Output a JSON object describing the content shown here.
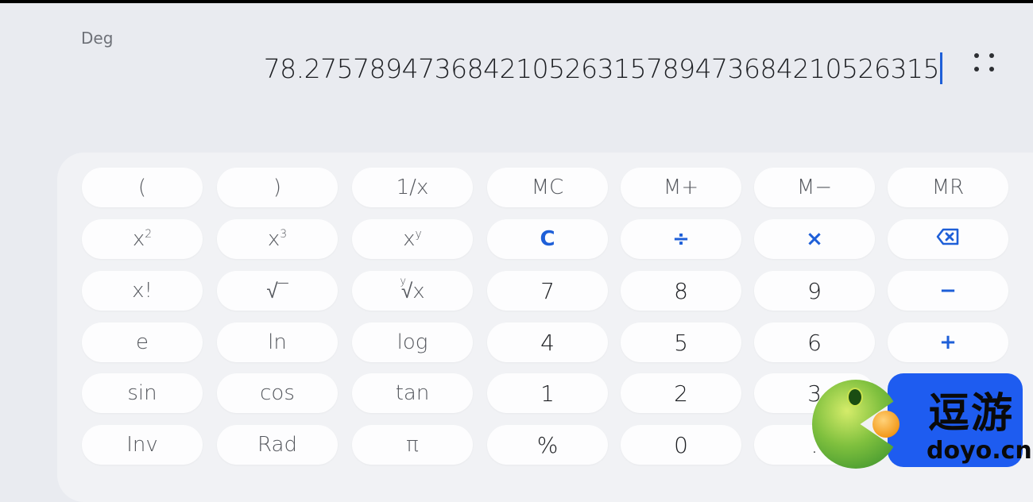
{
  "display": {
    "angle_mode": "Deg",
    "value": "78.275789473684210526315789473684210526315",
    "more_icon": "more-dots-icon"
  },
  "keypad": {
    "rows": [
      [
        {
          "label": "(",
          "type": "fn"
        },
        {
          "label": ")",
          "type": "fn"
        },
        {
          "label": "1/x",
          "type": "fn"
        },
        {
          "label": "MC",
          "type": "fn"
        },
        {
          "label": "M+",
          "type": "fn"
        },
        {
          "label": "M−",
          "type": "fn"
        },
        {
          "label": "MR",
          "type": "fn"
        }
      ],
      [
        {
          "label": "x²",
          "base": "x",
          "sup": "2",
          "type": "fn"
        },
        {
          "label": "x³",
          "base": "x",
          "sup": "3",
          "type": "fn"
        },
        {
          "label": "xʸ",
          "base": "x",
          "sup": "y",
          "type": "fn"
        },
        {
          "label": "C",
          "type": "op"
        },
        {
          "label": "÷",
          "type": "op"
        },
        {
          "label": "×",
          "type": "op"
        },
        {
          "label": "⌫",
          "type": "op",
          "icon": "backspace-icon"
        }
      ],
      [
        {
          "label": "x!",
          "type": "fn"
        },
        {
          "label": "√‾",
          "type": "fn"
        },
        {
          "label": "ʸ√x",
          "index": "y",
          "radicand": "√x",
          "type": "fn"
        },
        {
          "label": "7",
          "type": "num"
        },
        {
          "label": "8",
          "type": "num"
        },
        {
          "label": "9",
          "type": "num"
        },
        {
          "label": "−",
          "type": "op"
        }
      ],
      [
        {
          "label": "e",
          "type": "fn"
        },
        {
          "label": "ln",
          "type": "fn"
        },
        {
          "label": "log",
          "type": "fn"
        },
        {
          "label": "4",
          "type": "num"
        },
        {
          "label": "5",
          "type": "num"
        },
        {
          "label": "6",
          "type": "num"
        },
        {
          "label": "+",
          "type": "op"
        }
      ],
      [
        {
          "label": "sin",
          "type": "fn"
        },
        {
          "label": "cos",
          "type": "fn"
        },
        {
          "label": "tan",
          "type": "fn"
        },
        {
          "label": "1",
          "type": "num"
        },
        {
          "label": "2",
          "type": "num"
        },
        {
          "label": "3",
          "type": "num"
        },
        {
          "label": "=",
          "type": "equals"
        }
      ],
      [
        {
          "label": "Inv",
          "type": "fn"
        },
        {
          "label": "Rad",
          "type": "fn"
        },
        {
          "label": "π",
          "type": "fn"
        },
        {
          "label": "%",
          "type": "num"
        },
        {
          "label": "0",
          "type": "num"
        },
        {
          "label": ".",
          "type": "num"
        }
      ]
    ]
  },
  "watermark": {
    "text_cn": "逗游",
    "text_en": "doyo.cn"
  },
  "colors": {
    "accent": "#1e5fd8",
    "background": "#e9ebf0",
    "panel": "#f1f2f5",
    "key": "#fdfdfe"
  }
}
